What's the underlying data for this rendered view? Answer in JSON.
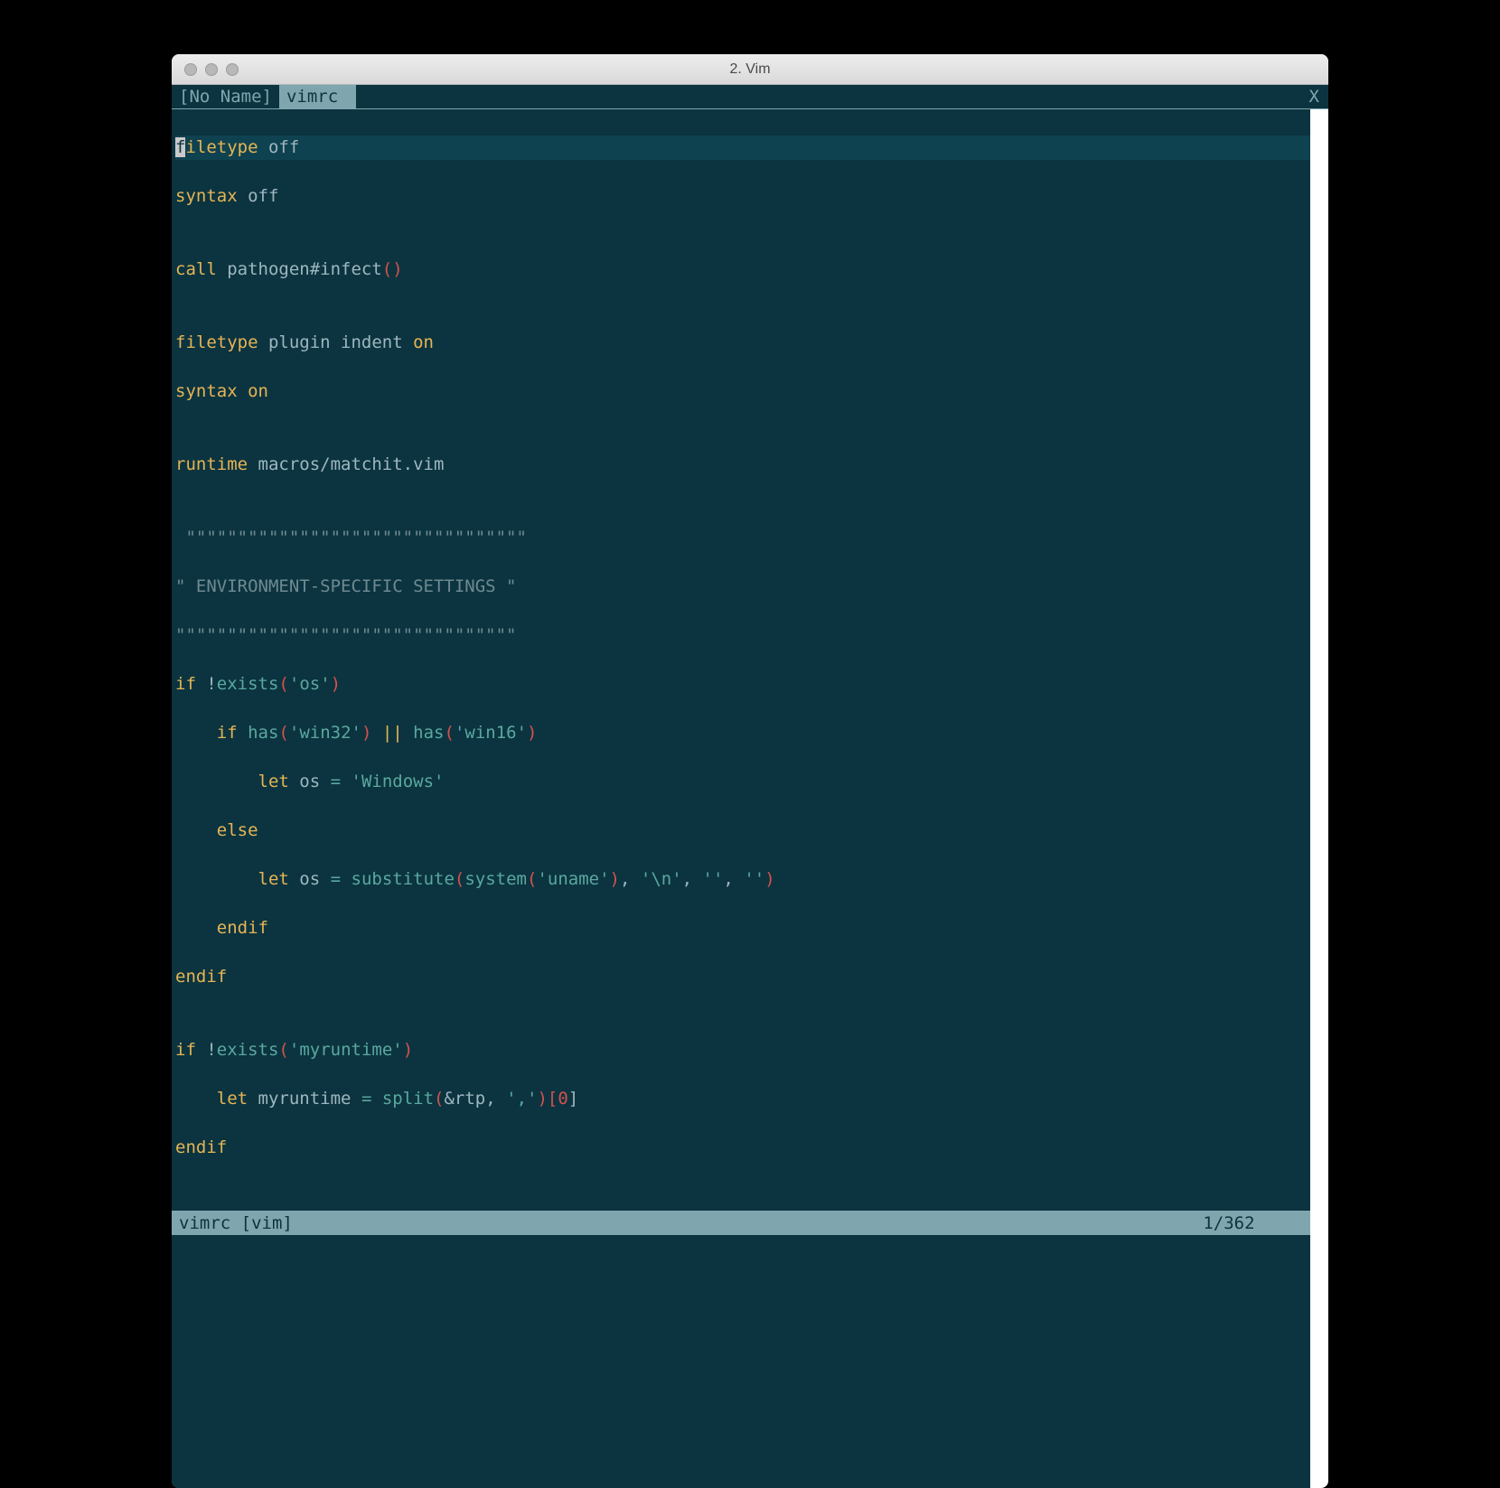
{
  "window": {
    "title": "2. Vim"
  },
  "tabs": {
    "inactive": "[No Name]",
    "active": "vimrc",
    "close": "X"
  },
  "code": {
    "l01": {
      "a": "f",
      "b": "iletype",
      "c": " off"
    },
    "l02": {
      "a": "syntax",
      "b": " off"
    },
    "l03": "",
    "l04": {
      "a": "call",
      "b": " pathogen#infect",
      "c": "()"
    },
    "l05": "",
    "l06": {
      "a": "filetype",
      "b": " plugin indent ",
      "c": "on"
    },
    "l07": {
      "a": "syntax",
      "b": " on"
    },
    "l08": "",
    "l09": {
      "a": "runtime",
      "b": " macros/matchit.vim"
    },
    "l10": "",
    "l11": " \"\"\"\"\"\"\"\"\"\"\"\"\"\"\"\"\"\"\"\"\"\"\"\"\"\"\"\"\"\"\"\"\"",
    "l12": "\" ENVIRONMENT-SPECIFIC SETTINGS \"",
    "l13": "\"\"\"\"\"\"\"\"\"\"\"\"\"\"\"\"\"\"\"\"\"\"\"\"\"\"\"\"\"\"\"\"\"",
    "l14": {
      "a": "if",
      "b": " !",
      "c": "exists",
      "d": "(",
      "e": "'os'",
      "f": ")"
    },
    "l15": {
      "pad": "    ",
      "a": "if",
      "b": " has",
      "c": "(",
      "d": "'win32'",
      "e": ")",
      "f": " || ",
      "g": "has",
      "h": "(",
      "i": "'win16'",
      "j": ")"
    },
    "l16": {
      "pad": "        ",
      "a": "let",
      "b": " os ",
      "c": "=",
      "d": " ",
      "e": "'Windows'"
    },
    "l17": {
      "pad": "    ",
      "a": "else"
    },
    "l18": {
      "pad": "        ",
      "a": "let",
      "b": " os ",
      "c": "=",
      "d": " substitute",
      "e": "(",
      "f": "system",
      "g": "(",
      "h": "'uname'",
      "i": ")",
      "j": ", ",
      "k": "'\\n'",
      "l": ", ",
      "m": "''",
      "n": ", ",
      "o": "''",
      "p": ")"
    },
    "l19": {
      "pad": "    ",
      "a": "endif"
    },
    "l20": {
      "a": "endif"
    },
    "l21": "",
    "l22": {
      "a": "if",
      "b": " !",
      "c": "exists",
      "d": "(",
      "e": "'myruntime'",
      "f": ")"
    },
    "l23": {
      "pad": "    ",
      "a": "let",
      "b": " myruntime ",
      "c": "=",
      "d": " split",
      "e": "(",
      "f": "&rtp, ",
      "g": "','",
      "h": ")[",
      "i": "0",
      "j": "]"
    },
    "l24": {
      "a": "endif"
    }
  },
  "status": {
    "left": " vimrc [vim]",
    "pos": "1/362",
    "col": "1"
  }
}
